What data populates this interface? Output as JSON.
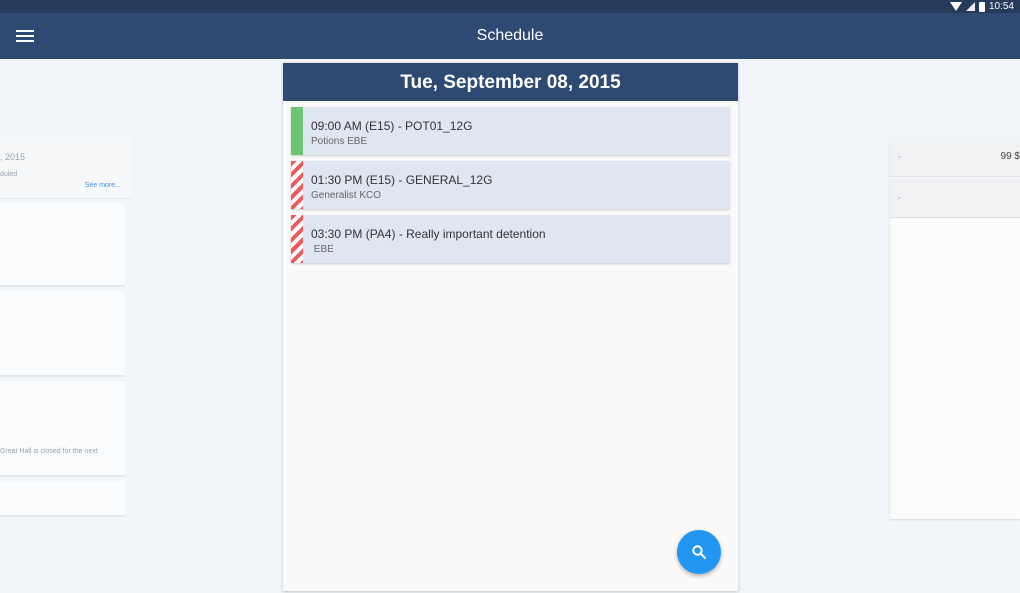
{
  "status_bar": {
    "time": "10:54"
  },
  "app_bar": {
    "title": "Schedule"
  },
  "main": {
    "date": "Tue, September 08, 2015",
    "events": [
      {
        "title": "09:00 AM (E15) - POT01_12G",
        "subtitle": "Potions EBE",
        "bar": "solid-green"
      },
      {
        "title": "01:30 PM (E15) - GENERAL_12G",
        "subtitle": "Generalist KCO",
        "bar": "striped-red"
      },
      {
        "title": "03:30 PM (PA4) - Really important detention",
        "subtitle": " EBE",
        "bar": "striped-red"
      }
    ]
  },
  "left_page": {
    "date_fragment": ", 2015",
    "subtitle_fragment": "duled",
    "link": "See more...",
    "note_fragment": "Great Hall is closed for the next"
  },
  "right_page": {
    "value": "99 $"
  },
  "colors": {
    "primary": "#2e4a73",
    "status_bar": "#263a5c",
    "accent": "#2196f3",
    "event_bg": "#dfe6f2",
    "green": "#6cc56f",
    "red": "#ef5b5b"
  },
  "icons": {
    "menu": "hamburger-icon",
    "fab": "search-icon"
  }
}
